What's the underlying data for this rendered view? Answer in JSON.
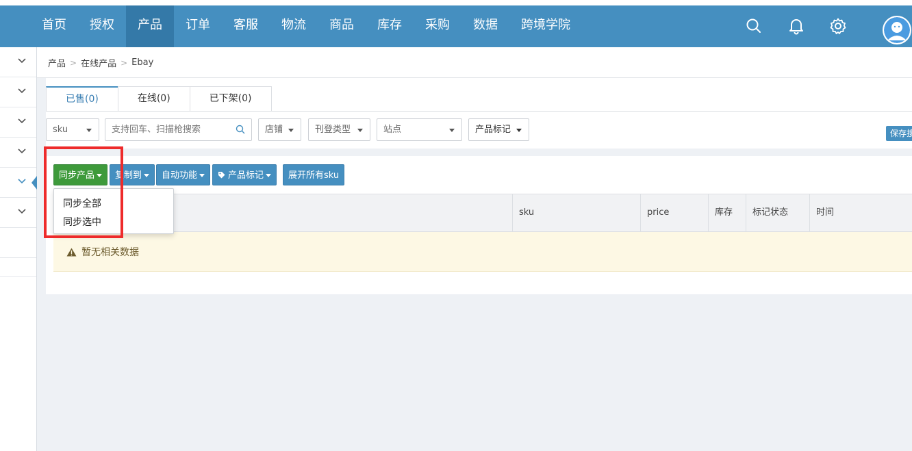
{
  "nav": {
    "items": [
      "首页",
      "授权",
      "产品",
      "订单",
      "客服",
      "物流",
      "商品",
      "库存",
      "采购",
      "数据",
      "跨境学院"
    ],
    "active_index": 2,
    "icons": [
      "search-icon",
      "bell-icon",
      "gear-icon",
      "user-avatar"
    ]
  },
  "breadcrumb": {
    "items": [
      "产品",
      "在线产品",
      "Ebay"
    ]
  },
  "tabs": [
    {
      "label": "已售(0)",
      "active": true
    },
    {
      "label": "在线(0)",
      "active": false
    },
    {
      "label": "已下架(0)",
      "active": false
    }
  ],
  "filters": {
    "sku_select": "sku",
    "search_placeholder": "支持回车、扫描枪搜索",
    "shop": "店铺",
    "listing_type": "刊登类型",
    "site": "站点",
    "product_mark": "产品标记",
    "save_label": "保存搜索"
  },
  "toolbar": {
    "sync": "同步产品",
    "copy": "复制到",
    "auto": "自动功能",
    "mark": "产品标记",
    "expand": "展开所有sku"
  },
  "sync_menu": {
    "items": [
      "同步全部",
      "同步选中"
    ]
  },
  "table": {
    "columns": [
      "sku",
      "price",
      "库存",
      "标记状态",
      "时间"
    ],
    "empty_message": "暂无相关数据"
  },
  "colors": {
    "primary": "#458fc0",
    "nav_active": "#3479a8",
    "success": "#3e9a3b",
    "highlight": "#ee2b2b"
  }
}
